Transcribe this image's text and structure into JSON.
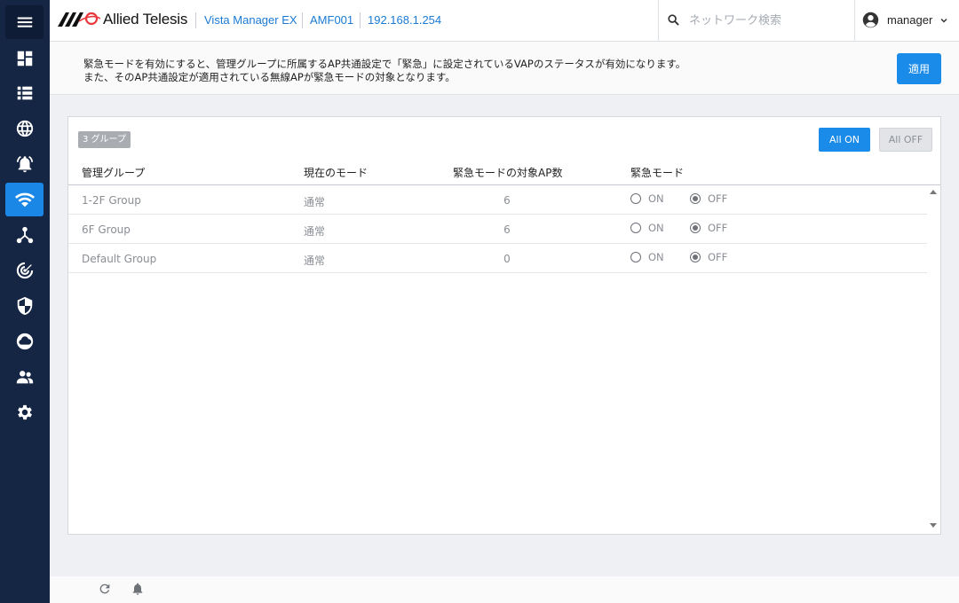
{
  "header": {
    "logo_text": "Allied Telesis",
    "breadcrumb": [
      "Vista Manager EX",
      "AMF001",
      "192.168.1.254"
    ],
    "search_placeholder": "ネットワーク検索",
    "user_name": "manager"
  },
  "sidebar": {
    "items": [
      {
        "icon": "menu-icon"
      },
      {
        "icon": "dashboard-icon"
      },
      {
        "icon": "list-icon"
      },
      {
        "icon": "globe-icon"
      },
      {
        "icon": "alarm-icon"
      },
      {
        "icon": "wifi-icon",
        "active": true
      },
      {
        "icon": "topology-icon"
      },
      {
        "icon": "radar-icon"
      },
      {
        "icon": "shield-icon"
      },
      {
        "icon": "cloud-icon"
      },
      {
        "icon": "users-icon"
      },
      {
        "icon": "settings-icon"
      }
    ]
  },
  "notice": {
    "line1": "緊急モードを有効にすると、管理グループに所属するAP共通設定で「緊急」に設定されているVAPのステータスが有効になります。",
    "line2": "また、そのAP共通設定が適用されている無線APが緊急モードの対象となります。",
    "apply_label": "適用"
  },
  "panel": {
    "group_badge": "3 グループ",
    "all_on_label": "All ON",
    "all_off_label": "All OFF",
    "columns": [
      "管理グループ",
      "現在のモード",
      "緊急モードの対象AP数",
      "緊急モード"
    ],
    "rows": [
      {
        "group": "1-2F Group",
        "mode": "通常",
        "count": "6",
        "emergency": "OFF"
      },
      {
        "group": "6F Group",
        "mode": "通常",
        "count": "6",
        "emergency": "OFF"
      },
      {
        "group": "Default Group",
        "mode": "通常",
        "count": "0",
        "emergency": "OFF"
      }
    ],
    "on_label": "ON",
    "off_label": "OFF"
  },
  "colors": {
    "sidebar_bg": "#152544",
    "accent": "#1a8be8",
    "link": "#1a7ad4"
  }
}
